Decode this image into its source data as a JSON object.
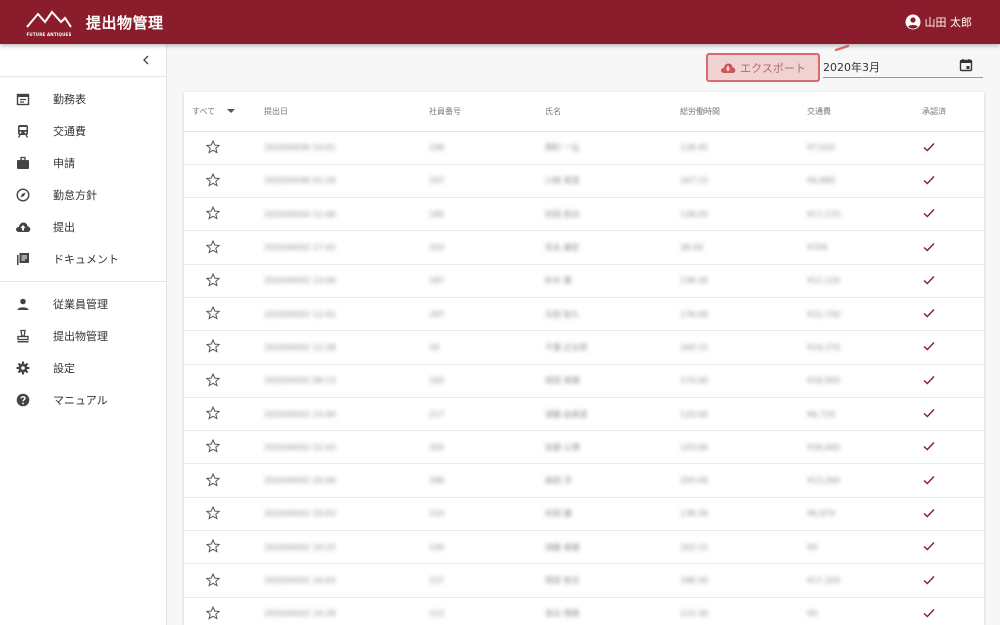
{
  "header": {
    "logo_text": "FUTURE ANTIQUES",
    "title": "提出物管理",
    "user_name": "山田 太郎"
  },
  "sidebar": {
    "collapse_icon": "chevron-left-icon",
    "group1": [
      {
        "label": "勤務表",
        "icon": "calendar-icon"
      },
      {
        "label": "交通費",
        "icon": "train-icon"
      },
      {
        "label": "申請",
        "icon": "briefcase-icon"
      },
      {
        "label": "勤怠方針",
        "icon": "compass-icon"
      },
      {
        "label": "提出",
        "icon": "cloud-upload-icon"
      },
      {
        "label": "ドキュメント",
        "icon": "library-icon"
      }
    ],
    "group2": [
      {
        "label": "従業員管理",
        "icon": "person-icon"
      },
      {
        "label": "提出物管理",
        "icon": "stamp-icon"
      },
      {
        "label": "設定",
        "icon": "gear-icon"
      },
      {
        "label": "マニュアル",
        "icon": "help-icon"
      }
    ]
  },
  "toolbar": {
    "export_label": "エクスポート",
    "month_value": "2020年3月"
  },
  "table": {
    "filter_label": "すべて",
    "columns": [
      "提出日",
      "社員番号",
      "氏名",
      "総労働時間",
      "交通費",
      "承認済"
    ],
    "rows": [
      {
        "date": "2020/04/06 14:01",
        "emp": "246",
        "name": "相町 一弘",
        "hours": "128:45",
        "trans": "¥7,020"
      },
      {
        "date": "2020/04/06 01:26",
        "emp": "207",
        "name": "川崎 美里",
        "hours": "167:15",
        "trans": "¥6,880"
      },
      {
        "date": "2020/04/04 11:06",
        "emp": "185",
        "name": "村田 拓也",
        "hours": "138:05",
        "trans": "¥17,170"
      },
      {
        "date": "2020/04/02 17:42",
        "emp": "203",
        "name": "先永 康史",
        "hours": "38:00",
        "trans": "¥704"
      },
      {
        "date": "2020/04/02 13:06",
        "emp": "187",
        "name": "鈴木 優",
        "hours": "138:30",
        "trans": "¥12,120"
      },
      {
        "date": "2020/04/02 12:42",
        "emp": "297",
        "name": "元田 智久",
        "hours": "176:00",
        "trans": "¥12,730"
      },
      {
        "date": "2020/04/02 12:38",
        "emp": "18",
        "name": "千葉 正太郎",
        "hours": "160:15",
        "trans": "¥19,270"
      },
      {
        "date": "2020/04/02 08:13",
        "emp": "165",
        "name": "坂田 美穂",
        "hours": "174:00",
        "trans": "¥18,950"
      },
      {
        "date": "2020/04/02 23:44",
        "emp": "217",
        "name": "須藤 由美里",
        "hours": "120:00",
        "trans": "¥6,720"
      },
      {
        "date": "2020/04/02 22:43",
        "emp": "265",
        "name": "安藤 公博",
        "hours": "143:00",
        "trans": "¥18,600"
      },
      {
        "date": "2020/04/02 20:06",
        "emp": "286",
        "name": "森田 洋",
        "hours": "205:00",
        "trans": "¥13,260"
      },
      {
        "date": "2020/04/02 20:03",
        "emp": "233",
        "name": "村田 謙",
        "hours": "138:30",
        "trans": "¥6,974"
      },
      {
        "date": "2020/04/02 19:25",
        "emp": "195",
        "name": "須藤 美穂",
        "hours": "202:15",
        "trans": "¥0"
      },
      {
        "date": "2020/04/02 16:03",
        "emp": "227",
        "name": "岡部 智也",
        "hours": "188:30",
        "trans": "¥17,320"
      },
      {
        "date": "2020/04/02 14:28",
        "emp": "112",
        "name": "長谷 理恵",
        "hours": "122:30",
        "trans": "¥0"
      }
    ]
  },
  "colors": {
    "brand": "#8a1c2b",
    "check": "#8a1c2b",
    "export_border": "#d86b6b"
  }
}
